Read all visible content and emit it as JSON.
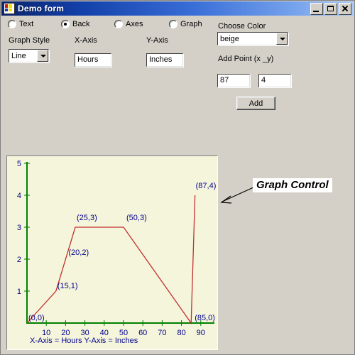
{
  "window": {
    "title": "Demo form",
    "icon": "form-designer-icon",
    "buttons": {
      "minimize": "_",
      "maximize": "□",
      "close": "×"
    }
  },
  "radios": [
    {
      "label": "Text",
      "selected": false
    },
    {
      "label": "Back",
      "selected": true
    },
    {
      "label": "Axes",
      "selected": false
    },
    {
      "label": "Graph",
      "selected": false
    }
  ],
  "form": {
    "graph_style_label": "Graph Style",
    "graph_style_value": "Line",
    "x_axis_label": "X-Axis",
    "x_axis_value": "Hours",
    "y_axis_label": "Y-Axis",
    "y_axis_value": "Inches",
    "choose_color_label": "Choose Color",
    "choose_color_value": "beige",
    "add_point_label": "Add Point (x _y)",
    "add_point_x": "87",
    "add_point_y": "4",
    "add_button": "Add"
  },
  "callout": {
    "text": "Graph Control"
  },
  "chart_data": {
    "type": "line",
    "title": "",
    "xlabel": "X-Axis = Hours",
    "ylabel": "Y-Axis = Inches",
    "footer": "X-Axis = Hours    Y-Axis = Inches",
    "xlim": [
      0,
      95
    ],
    "ylim": [
      0,
      5
    ],
    "xticks": [
      10,
      20,
      30,
      40,
      50,
      60,
      70,
      80,
      90
    ],
    "yticks": [
      1,
      2,
      3,
      4,
      5
    ],
    "grid": false,
    "legend": false,
    "line_color": "#c03030",
    "axis_color": "#008000",
    "label_color": "#00008b",
    "background": "#f5f5dc",
    "points": [
      {
        "x": 0,
        "y": 0,
        "label": "(0,0)"
      },
      {
        "x": 15,
        "y": 1,
        "label": "(15,1)"
      },
      {
        "x": 20,
        "y": 2,
        "label": "(20,2)"
      },
      {
        "x": 25,
        "y": 3,
        "label": "(25,3)"
      },
      {
        "x": 50,
        "y": 3,
        "label": "(50,3)"
      },
      {
        "x": 85,
        "y": 0,
        "label": "(85,0)"
      },
      {
        "x": 87,
        "y": 4,
        "label": "(87,4)"
      }
    ]
  }
}
